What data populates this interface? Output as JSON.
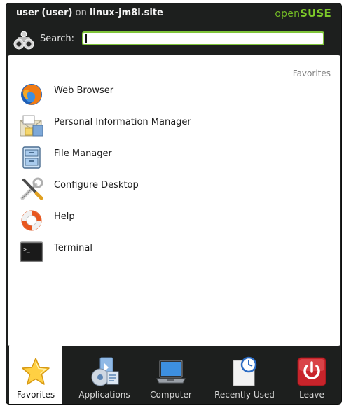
{
  "header": {
    "user_name": "user",
    "user_login": "(user)",
    "on_text": "on",
    "host": "linux-jm8i.site",
    "brand_open": "open",
    "brand_suse": "SUSE"
  },
  "search": {
    "label": "Search:",
    "value": "",
    "placeholder": ""
  },
  "section": {
    "title": "Favorites"
  },
  "favorites": [
    {
      "label": "Web Browser",
      "icon": "firefox-icon"
    },
    {
      "label": "Personal Information Manager",
      "icon": "pim-icon"
    },
    {
      "label": "File Manager",
      "icon": "file-manager-icon"
    },
    {
      "label": "Configure Desktop",
      "icon": "configure-icon"
    },
    {
      "label": "Help",
      "icon": "help-lifebuoy-icon"
    },
    {
      "label": "Terminal",
      "icon": "terminal-icon"
    }
  ],
  "tabs": [
    {
      "label": "Favorites",
      "icon": "star-icon",
      "active": true
    },
    {
      "label": "Applications",
      "icon": "applications-icon",
      "active": false
    },
    {
      "label": "Computer",
      "icon": "laptop-icon",
      "active": false
    },
    {
      "label": "Recently Used",
      "icon": "recent-clock-icon",
      "active": false
    },
    {
      "label": "Leave",
      "icon": "power-icon",
      "active": false
    }
  ],
  "colors": {
    "background_dark": "#1d1f1e",
    "brand_green": "#73ba25",
    "search_border": "#7fc43a",
    "leave_red": "#c8242b"
  }
}
